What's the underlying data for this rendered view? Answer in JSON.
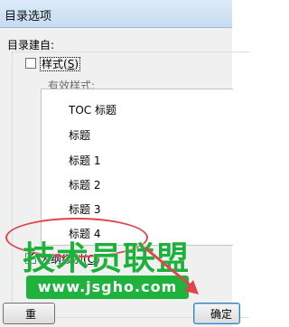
{
  "window": {
    "title": "目录选项"
  },
  "dialog": {
    "section_label": "目录建自:",
    "styles_checkbox": {
      "label_main": "样式(",
      "label_key": "S",
      "label_end": ")",
      "checked": false
    },
    "available_styles_label": "有效样式:",
    "styles_list": [
      {
        "label": "TOC 标题"
      },
      {
        "label": "标题"
      },
      {
        "label": "标题 1"
      },
      {
        "label": "标题 2"
      },
      {
        "label": "标题 3"
      },
      {
        "label": "标题 4"
      }
    ],
    "outline_checkbox": {
      "label_main": "大纲级别(",
      "label_key": "O",
      "label_end": ")",
      "checked": true,
      "tick": "✔"
    },
    "buttons": {
      "reset": "重",
      "ok": "确定"
    }
  },
  "watermark": {
    "title": "技术员联盟",
    "url": "www.jsgho.com"
  },
  "colors": {
    "annotation": "#e0444d",
    "watermark": "#1cb13a"
  }
}
